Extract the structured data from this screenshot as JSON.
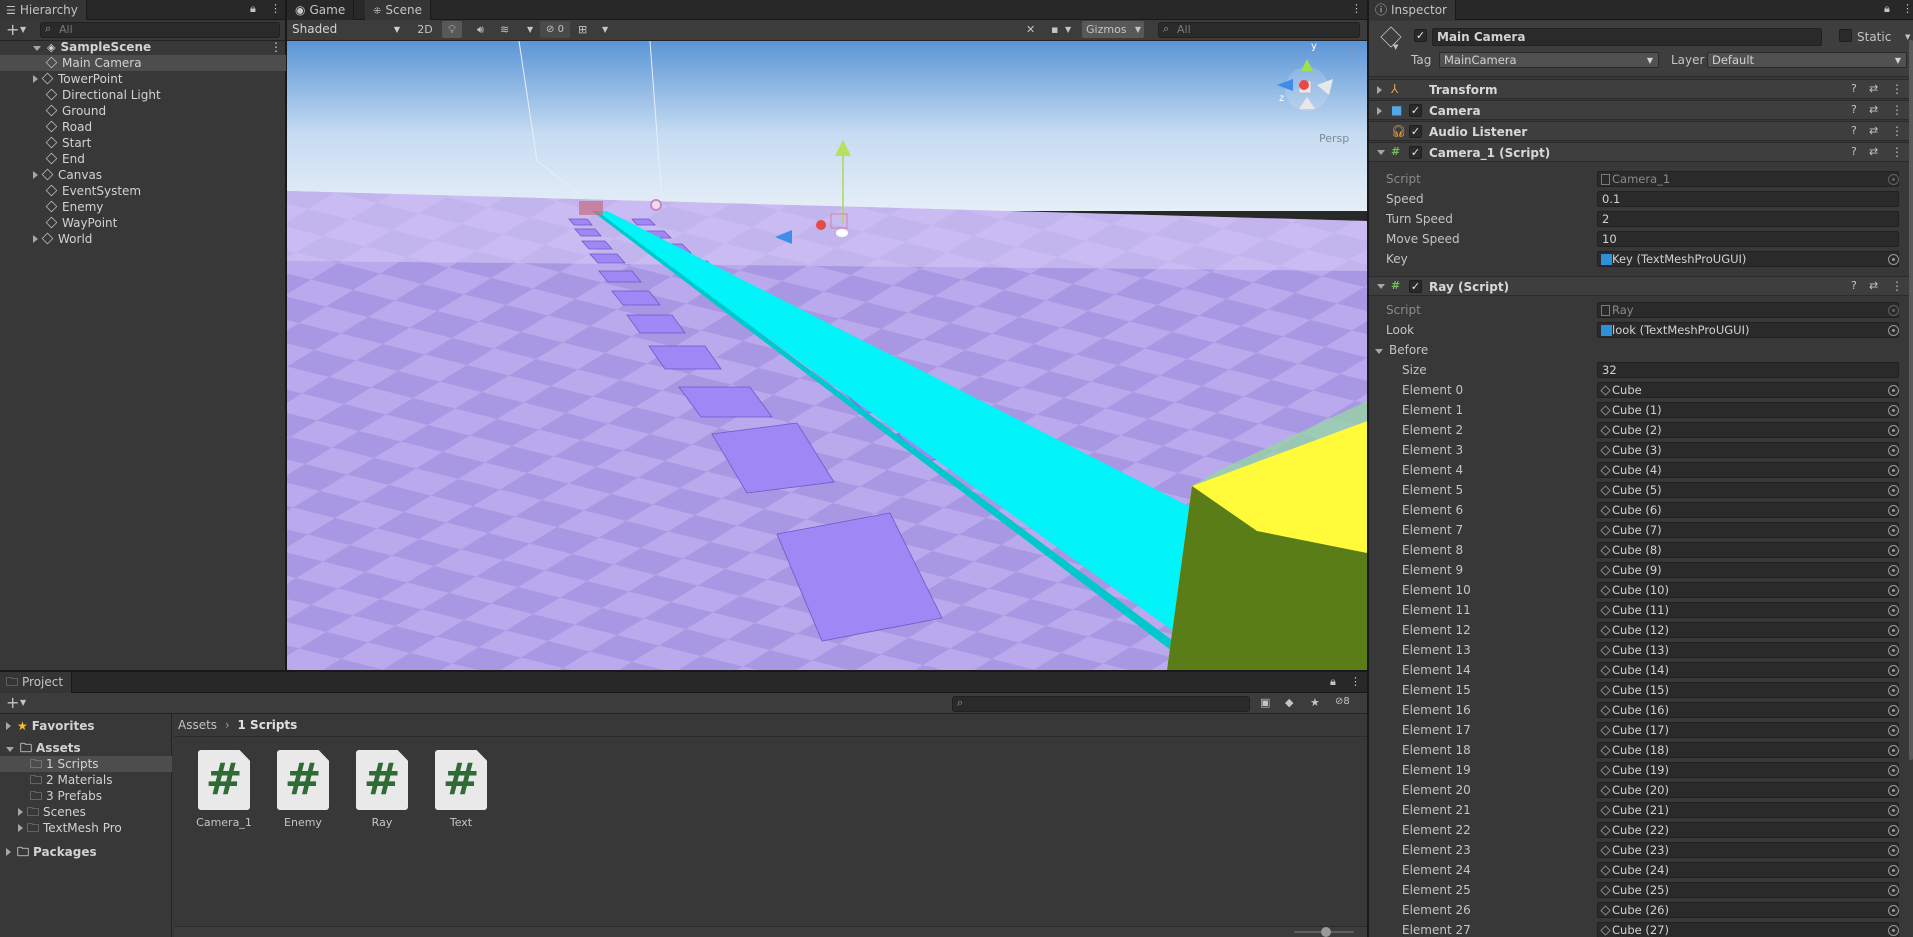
{
  "hierarchy": {
    "tab": "Hierarchy",
    "search_placeholder": "All",
    "scene": "SampleScene",
    "items": [
      {
        "label": "Main Camera",
        "expand": false,
        "selected": true
      },
      {
        "label": "TowerPoint",
        "expand": true
      },
      {
        "label": "Directional Light",
        "expand": false
      },
      {
        "label": "Ground",
        "expand": false
      },
      {
        "label": "Road",
        "expand": false
      },
      {
        "label": "Start",
        "expand": false
      },
      {
        "label": "End",
        "expand": false
      },
      {
        "label": "Canvas",
        "expand": true
      },
      {
        "label": "EventSystem",
        "expand": false
      },
      {
        "label": "Enemy",
        "expand": false
      },
      {
        "label": "WayPoint",
        "expand": false
      },
      {
        "label": "World",
        "expand": true
      }
    ]
  },
  "scene_view": {
    "tabs": [
      "Game",
      "Scene"
    ],
    "shading": "Shaded",
    "mode_2d": "2D",
    "hidden_count": "0",
    "gizmos": "Gizmos",
    "search_placeholder": "All",
    "projection": "Persp"
  },
  "project": {
    "tab": "Project",
    "favorites": "Favorites",
    "assets": "Assets",
    "folders": [
      "1 Scripts",
      "2 Materials",
      "3 Prefabs",
      "Scenes",
      "TextMesh Pro"
    ],
    "packages": "Packages",
    "breadcrumb": [
      "Assets",
      "1 Scripts"
    ],
    "hidden_count": "8",
    "files": [
      "Camera_1",
      "Enemy",
      "Ray",
      "Text"
    ]
  },
  "inspector": {
    "tab": "Inspector",
    "object_name": "Main Camera",
    "static_label": "Static",
    "tag_label": "Tag",
    "tag_value": "MainCamera",
    "layer_label": "Layer",
    "layer_value": "Default",
    "components": {
      "transform": "Transform",
      "camera": "Camera",
      "audio": "Audio Listener",
      "camera_script": "Camera_1 (Script)",
      "ray_script": "Ray (Script)"
    },
    "camera_script": {
      "script_label": "Script",
      "script_value": "Camera_1",
      "speed_label": "Speed",
      "speed_value": "0.1",
      "turn_label": "Turn Speed",
      "turn_value": "2",
      "move_label": "Move Speed",
      "move_value": "10",
      "key_label": "Key",
      "key_value": "Key (TextMeshProUGUI)"
    },
    "ray_script": {
      "script_label": "Script",
      "script_value": "Ray",
      "look_label": "Look",
      "look_value": "look (TextMeshProUGUI)",
      "before_label": "Before",
      "size_label": "Size",
      "size_value": "32"
    },
    "elements": [
      {
        "label": "Element 0",
        "value": "Cube"
      },
      {
        "label": "Element 1",
        "value": "Cube (1)"
      },
      {
        "label": "Element 2",
        "value": "Cube (2)"
      },
      {
        "label": "Element 3",
        "value": "Cube (3)"
      },
      {
        "label": "Element 4",
        "value": "Cube (4)"
      },
      {
        "label": "Element 5",
        "value": "Cube (5)"
      },
      {
        "label": "Element 6",
        "value": "Cube (6)"
      },
      {
        "label": "Element 7",
        "value": "Cube (7)"
      },
      {
        "label": "Element 8",
        "value": "Cube (8)"
      },
      {
        "label": "Element 9",
        "value": "Cube (9)"
      },
      {
        "label": "Element 10",
        "value": "Cube (10)"
      },
      {
        "label": "Element 11",
        "value": "Cube (11)"
      },
      {
        "label": "Element 12",
        "value": "Cube (12)"
      },
      {
        "label": "Element 13",
        "value": "Cube (13)"
      },
      {
        "label": "Element 14",
        "value": "Cube (14)"
      },
      {
        "label": "Element 15",
        "value": "Cube (15)"
      },
      {
        "label": "Element 16",
        "value": "Cube (16)"
      },
      {
        "label": "Element 17",
        "value": "Cube (17)"
      },
      {
        "label": "Element 18",
        "value": "Cube (18)"
      },
      {
        "label": "Element 19",
        "value": "Cube (19)"
      },
      {
        "label": "Element 20",
        "value": "Cube (20)"
      },
      {
        "label": "Element 21",
        "value": "Cube (21)"
      },
      {
        "label": "Element 22",
        "value": "Cube (22)"
      },
      {
        "label": "Element 23",
        "value": "Cube (23)"
      },
      {
        "label": "Element 24",
        "value": "Cube (24)"
      },
      {
        "label": "Element 25",
        "value": "Cube (25)"
      },
      {
        "label": "Element 26",
        "value": "Cube (26)"
      },
      {
        "label": "Element 27",
        "value": "Cube (27)"
      }
    ]
  }
}
